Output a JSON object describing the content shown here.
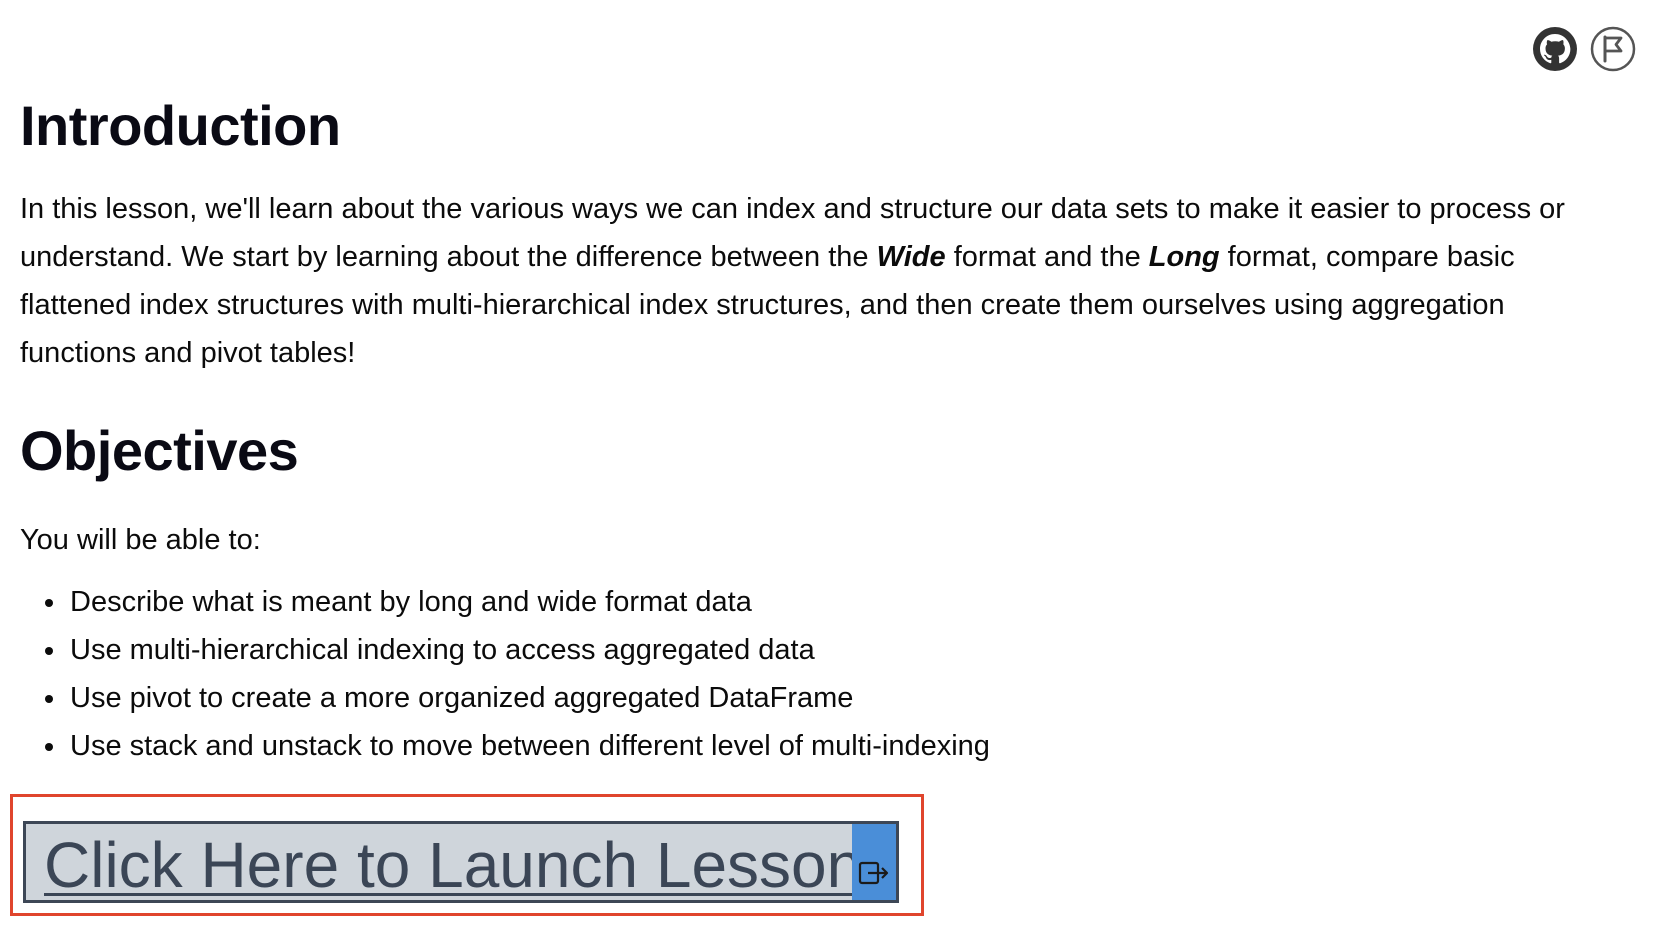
{
  "header": {
    "icons": [
      {
        "name": "github-icon"
      },
      {
        "name": "flag-icon"
      }
    ]
  },
  "introduction": {
    "title": "Introduction",
    "text_before_wide": "In this lesson, we'll learn about the various ways we can index and structure our data sets to make it easier to process or understand. We start by learning about the difference between the ",
    "wide": "Wide",
    "text_between": " format and the ",
    "long": "Long",
    "text_after_long": " format, compare basic flattened index structures with multi-hierarchical index structures, and then create them ourselves using aggregation functions and pivot tables!"
  },
  "objectives": {
    "title": "Objectives",
    "lead": "You will be able to:",
    "items": [
      "Describe what is meant by long and wide format data",
      "Use multi-hierarchical indexing to access aggregated data",
      "Use pivot to create a more organized aggregated DataFrame",
      "Use stack and unstack to move between different level of multi-indexing"
    ]
  },
  "launch": {
    "label": "Click Here to Launch Lesson",
    "icon": "external-link-icon"
  }
}
